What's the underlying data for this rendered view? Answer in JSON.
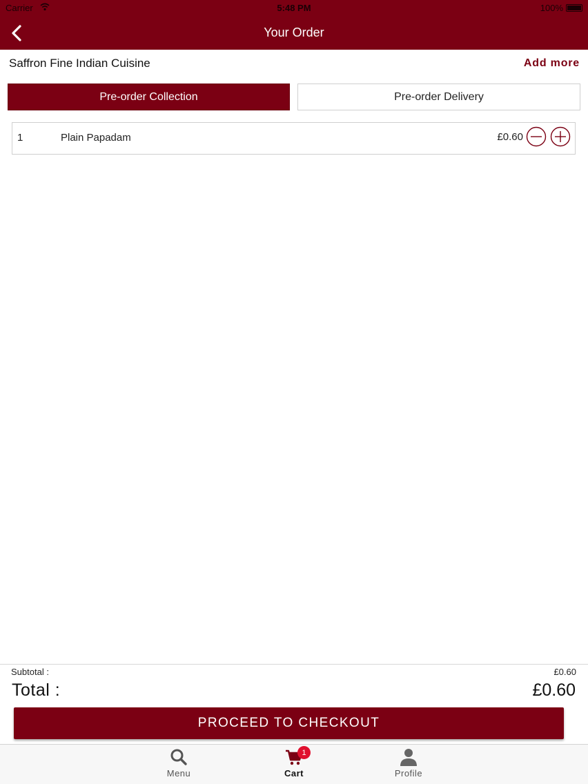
{
  "status_bar": {
    "carrier": "Carrier",
    "time": "5:48 PM",
    "battery": "100%"
  },
  "nav": {
    "title": "Your Order"
  },
  "restaurant": {
    "name": "Saffron Fine Indian Cuisine",
    "add_more": "Add more"
  },
  "order_type": {
    "collection": "Pre-order Collection",
    "delivery": "Pre-order Delivery",
    "selected": "collection"
  },
  "items": [
    {
      "qty": "1",
      "name": "Plain Papadam",
      "price": "£0.60"
    }
  ],
  "summary": {
    "subtotal_label": "Subtotal :",
    "subtotal": "£0.60",
    "total_label": "Total :",
    "total": "£0.60"
  },
  "checkout_label": "PROCEED TO CHECKOUT",
  "tabs": [
    {
      "label": "Menu",
      "icon": "search-icon"
    },
    {
      "label": "Cart",
      "icon": "cart-icon",
      "badge": "1"
    },
    {
      "label": "Profile",
      "icon": "profile-icon"
    }
  ],
  "colors": {
    "brand": "#7b0013",
    "badge": "#e0102e"
  }
}
